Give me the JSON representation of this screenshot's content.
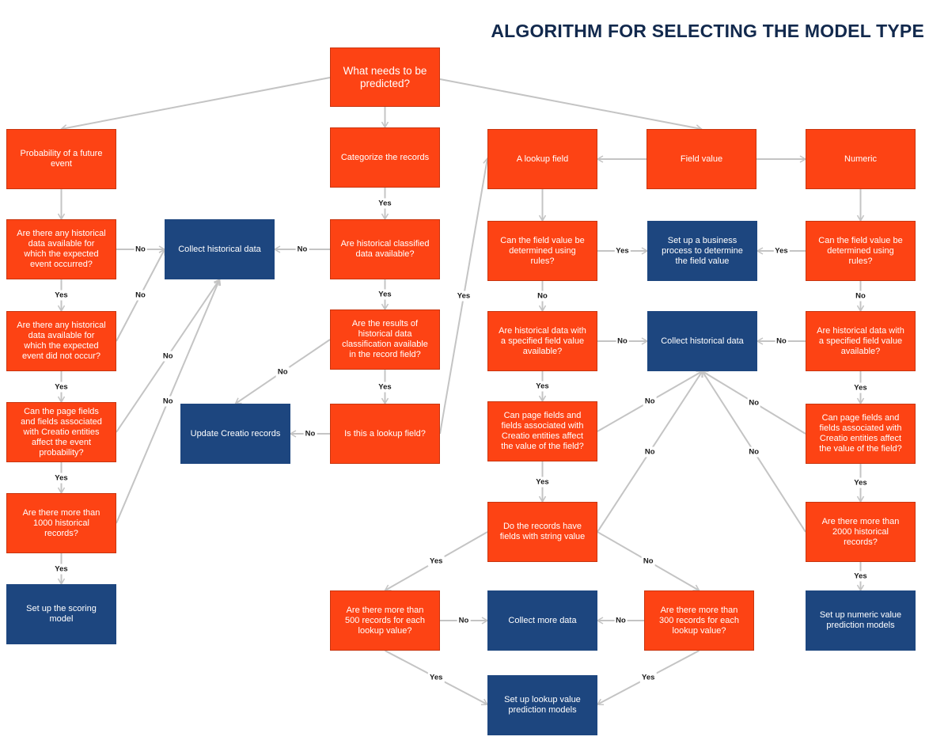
{
  "title": "ALGORITHM FOR SELECTING THE MODEL TYPE",
  "colors": {
    "decision": "#fd4314",
    "action": "#1d467f",
    "connector": "#c4c4c4",
    "title": "#12294d"
  },
  "nodes": [
    {
      "id": "start",
      "type": "decision",
      "text": "What needs to be predicted?"
    },
    {
      "id": "prob",
      "type": "decision",
      "text": "Probability of a future event"
    },
    {
      "id": "categorize",
      "type": "decision",
      "text": "Categorize the records"
    },
    {
      "id": "lookup",
      "type": "decision",
      "text": "A lookup field"
    },
    {
      "id": "fieldvalue",
      "type": "decision",
      "text": "Field value"
    },
    {
      "id": "numeric",
      "type": "decision",
      "text": "Numeric"
    },
    {
      "id": "p_q1",
      "type": "decision",
      "text": "Are there any historical data available for which the expected event occurred?"
    },
    {
      "id": "collect_left",
      "type": "action",
      "text": "Collect historical data"
    },
    {
      "id": "c_q1",
      "type": "decision",
      "text": "Are historical classified data available?"
    },
    {
      "id": "l_q1",
      "type": "decision",
      "text": "Can the field value be determined using rules?"
    },
    {
      "id": "bizproc",
      "type": "action",
      "text": "Set up a business process to determine the field value"
    },
    {
      "id": "n_q1",
      "type": "decision",
      "text": "Can the field value be determined using rules?"
    },
    {
      "id": "p_q2",
      "type": "decision",
      "text": "Are there any historical data available for which the expected event did not occur?"
    },
    {
      "id": "c_q2",
      "type": "decision",
      "text": "Are the results of historical data classification available in the record field?"
    },
    {
      "id": "l_q2",
      "type": "decision",
      "text": "Are historical data with a specified field value available?"
    },
    {
      "id": "collect_right",
      "type": "action",
      "text": "Collect historical data"
    },
    {
      "id": "n_q2",
      "type": "decision",
      "text": "Are historical data with a specified field value available?"
    },
    {
      "id": "p_q3",
      "type": "decision",
      "text": "Can the page fields and fields associated with Creatio entities affect the event probability?"
    },
    {
      "id": "update",
      "type": "action",
      "text": "Update Creatio records"
    },
    {
      "id": "c_q3",
      "type": "decision",
      "text": "Is this a lookup field?"
    },
    {
      "id": "l_q3",
      "type": "decision",
      "text": "Can page fields and fields associated with Creatio entities affect the value of the field?"
    },
    {
      "id": "n_q3",
      "type": "decision",
      "text": "Can page fields and fields associated with Creatio entities affect the value of the field?"
    },
    {
      "id": "p_q4",
      "type": "decision",
      "text": "Are there more than 1000 historical records?"
    },
    {
      "id": "l_q4",
      "type": "decision",
      "text": "Do the records have fields with string value"
    },
    {
      "id": "n_q4",
      "type": "decision",
      "text": "Are there more than 2000 historical records?"
    },
    {
      "id": "scoring",
      "type": "action",
      "text": "Set up the scoring model"
    },
    {
      "id": "l_500",
      "type": "decision",
      "text": "Are there more than 500 records for each lookup value?"
    },
    {
      "id": "collect_more",
      "type": "action",
      "text": "Collect more data"
    },
    {
      "id": "l_300",
      "type": "decision",
      "text": "Are there more than 300 records for each lookup value?"
    },
    {
      "id": "numeric_models",
      "type": "action",
      "text": "Set up numeric value prediction models"
    },
    {
      "id": "lookup_models",
      "type": "action",
      "text": "Set up lookup value prediction models"
    }
  ],
  "edges": [
    {
      "from": "start",
      "to": "prob",
      "label": ""
    },
    {
      "from": "start",
      "to": "categorize",
      "label": ""
    },
    {
      "from": "start",
      "to": "fieldvalue",
      "label": ""
    },
    {
      "from": "prob",
      "to": "p_q1",
      "label": ""
    },
    {
      "from": "p_q1",
      "to": "collect_left",
      "label": "No"
    },
    {
      "from": "p_q1",
      "to": "p_q2",
      "label": "Yes"
    },
    {
      "from": "p_q2",
      "to": "collect_left",
      "label": "No"
    },
    {
      "from": "p_q2",
      "to": "p_q3",
      "label": "Yes"
    },
    {
      "from": "p_q3",
      "to": "collect_left",
      "label": "No"
    },
    {
      "from": "p_q3",
      "to": "p_q4",
      "label": "Yes"
    },
    {
      "from": "p_q4",
      "to": "collect_left",
      "label": "No"
    },
    {
      "from": "p_q4",
      "to": "scoring",
      "label": "Yes"
    },
    {
      "from": "categorize",
      "to": "c_q1",
      "label": "Yes"
    },
    {
      "from": "c_q1",
      "to": "collect_left",
      "label": "No"
    },
    {
      "from": "c_q1",
      "to": "c_q2",
      "label": "Yes"
    },
    {
      "from": "c_q2",
      "to": "update",
      "label": "No"
    },
    {
      "from": "c_q2",
      "to": "c_q3",
      "label": "Yes"
    },
    {
      "from": "c_q3",
      "to": "update",
      "label": "No"
    },
    {
      "from": "c_q3",
      "to": "lookup",
      "label": "Yes"
    },
    {
      "from": "fieldvalue",
      "to": "lookup",
      "label": ""
    },
    {
      "from": "fieldvalue",
      "to": "numeric",
      "label": ""
    },
    {
      "from": "lookup",
      "to": "l_q1",
      "label": ""
    },
    {
      "from": "l_q1",
      "to": "bizproc",
      "label": "Yes"
    },
    {
      "from": "l_q1",
      "to": "l_q2",
      "label": "No"
    },
    {
      "from": "l_q2",
      "to": "collect_right",
      "label": "No"
    },
    {
      "from": "l_q2",
      "to": "l_q3",
      "label": "Yes"
    },
    {
      "from": "l_q3",
      "to": "collect_right",
      "label": "No"
    },
    {
      "from": "l_q3",
      "to": "l_q4",
      "label": "Yes"
    },
    {
      "from": "l_q4",
      "to": "collect_right",
      "label": "No"
    },
    {
      "from": "l_q4",
      "to": "l_500",
      "label": "Yes"
    },
    {
      "from": "l_q4",
      "to": "l_300",
      "label": "No"
    },
    {
      "from": "l_500",
      "to": "collect_more",
      "label": "No"
    },
    {
      "from": "l_500",
      "to": "lookup_models",
      "label": "Yes"
    },
    {
      "from": "l_300",
      "to": "collect_more",
      "label": "No"
    },
    {
      "from": "l_300",
      "to": "lookup_models",
      "label": "Yes"
    },
    {
      "from": "numeric",
      "to": "n_q1",
      "label": ""
    },
    {
      "from": "n_q1",
      "to": "bizproc",
      "label": "Yes"
    },
    {
      "from": "n_q1",
      "to": "n_q2",
      "label": "No"
    },
    {
      "from": "n_q2",
      "to": "collect_right",
      "label": "No"
    },
    {
      "from": "n_q2",
      "to": "n_q3",
      "label": "Yes"
    },
    {
      "from": "n_q3",
      "to": "collect_right",
      "label": "No"
    },
    {
      "from": "n_q3",
      "to": "n_q4",
      "label": "Yes"
    },
    {
      "from": "n_q4",
      "to": "collect_right",
      "label": "No"
    },
    {
      "from": "n_q4",
      "to": "numeric_models",
      "label": "Yes"
    }
  ]
}
